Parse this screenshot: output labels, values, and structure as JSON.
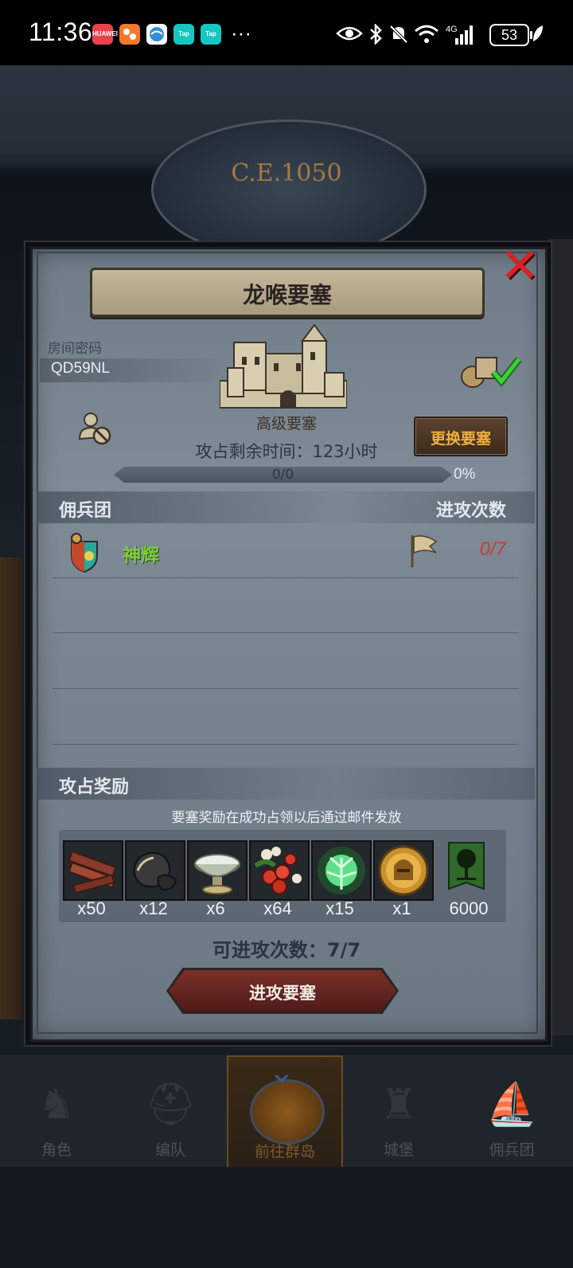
{
  "status_bar": {
    "time": "11:36",
    "apps": [
      {
        "name": "huawei-app-icon",
        "label": "HUAWEI",
        "color": "#e8434b"
      },
      {
        "name": "photo-app-icon",
        "label": "",
        "color": "#f07a2a"
      },
      {
        "name": "globe-app-icon",
        "label": "",
        "color": "#2f8fd8"
      },
      {
        "name": "taptap-app-icon-1",
        "label": "Tap",
        "color": "#16c6c0"
      },
      {
        "name": "taptap-app-icon-2",
        "label": "Tap",
        "color": "#16c6c0"
      }
    ],
    "more": "···",
    "network": "4G",
    "battery": "53"
  },
  "background": {
    "era": "C.E.1050"
  },
  "dialog": {
    "title": "龙喉要塞",
    "room": {
      "label": "房间密码",
      "code": "QD59NL"
    },
    "fortress_tier": "高级要塞",
    "change_button": "更换要塞",
    "remaining_time": "攻占剩余时间：123小时",
    "progress": {
      "text": "0/0",
      "percent": "0%",
      "value": 0
    },
    "mercenary_header": {
      "left": "佣兵团",
      "right": "进攻次数"
    },
    "mercenaries": [
      {
        "name": "神辉",
        "attempts": "0/7"
      }
    ],
    "rewards_header": "攻占奖励",
    "reward_note": "要塞奖励在成功占领以后通过邮件发放",
    "rewards": [
      {
        "icon": "wood-planks-icon",
        "count": "x50"
      },
      {
        "icon": "black-stone-icon",
        "count": "x12"
      },
      {
        "icon": "silver-bowl-icon",
        "count": "x6"
      },
      {
        "icon": "red-berries-icon",
        "count": "x64"
      },
      {
        "icon": "green-spirit-icon",
        "count": "x15"
      },
      {
        "icon": "gold-helmet-medal-icon",
        "count": "x1"
      },
      {
        "icon": "tree-banner-icon",
        "count": "6000"
      }
    ],
    "attack_count": "可进攻次数：7/7",
    "attack_button": "进攻要塞"
  },
  "bottom_nav": {
    "items": [
      {
        "label": "角色",
        "icon": "knight-icon"
      },
      {
        "label": "编队",
        "icon": "helmet-icon"
      },
      {
        "label": "前往群岛",
        "icon": "globe-icon",
        "active": true
      },
      {
        "label": "城堡",
        "icon": "castle-icon"
      },
      {
        "label": "佣兵团",
        "icon": "ship-icon"
      }
    ]
  },
  "colors": {
    "accent_gold": "#f0b040",
    "merc_name_green": "#7ccf3a",
    "attempts_red": "#c83a3a",
    "close_red": "#d42424"
  }
}
